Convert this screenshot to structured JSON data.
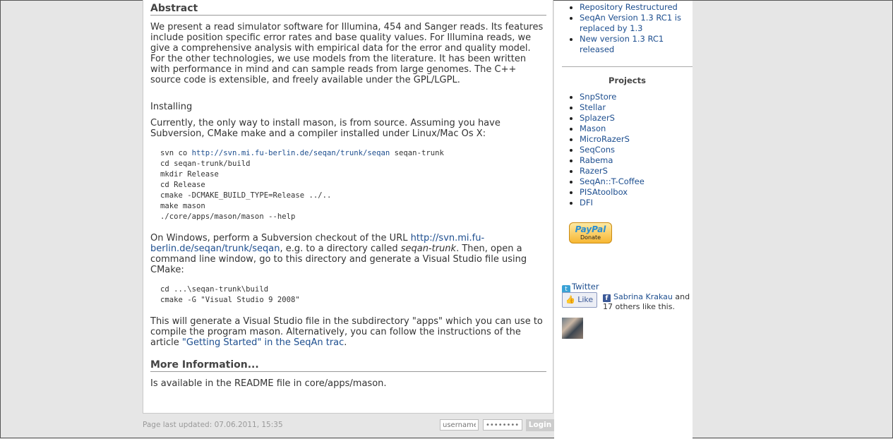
{
  "main": {
    "abstract_heading": "Abstract",
    "abstract_text": "We present a read simulator software for Illumina, 454 and Sanger reads. Its features include position specific error rates and base quality values. For Illumina reads, we give a comprehensive analysis with empirical data for the error and quality model. For the other technologies, we use models from the literature. It has been written with performance in mind and can sample reads from large genomes. The C++ source code is extensible, and freely available under the GPL/LGPL.",
    "installing_label": "Installing",
    "install_intro": "Currently, the only way to install mason, is from source. Assuming you have Subversion, CMake make and a compiler installed under Linux/Mac Os X:",
    "code1": {
      "line1_prefix": "svn co ",
      "line1_link": "http://svn.mi.fu-berlin.de/seqan/trunk/seqan",
      "line1_suffix": " seqan-trunk",
      "line2": "cd seqan-trunk/build",
      "line3": "mkdir Release",
      "line4": "cd Release",
      "line5": "cmake -DCMAKE_BUILD_TYPE=Release ../..",
      "line6": "make mason",
      "line7": "./core/apps/mason/mason --help"
    },
    "windows_text_1": "On Windows, perform a Subversion checkout of the URL ",
    "windows_link": "http://svn.mi.fu-berlin.de/seqan/trunk/seqan",
    "windows_text_2": ", e.g. to a directory called ",
    "windows_em": "seqan-trunk",
    "windows_text_3": ". Then, open a command line window, go to this directory and generate a Visual Studio file using CMake:",
    "code2": {
      "line1": "cd ...\\seqan-trunk\\build",
      "line2": "cmake -G \"Visual Studio 9 2008\""
    },
    "generate_text": "This will generate a Visual Studio file in the subdirectory \"apps\" which you can use to compile the program mason. Alternatively, you can follow the instructions of the article ",
    "getting_started_link": "\"Getting Started\" in the SeqAn trac",
    "generate_text_end": ".",
    "more_info_heading": "More Information...",
    "more_info_text": "Is available in the README file in core/apps/mason."
  },
  "sidebar": {
    "news": [
      "Repository Restructured",
      "SeqAn Version 1.3 RC1 is replaced by 1.3",
      "New version 1.3 RC1 released"
    ],
    "projects_title": "Projects",
    "projects": [
      "SnpStore",
      "Stellar",
      "SplazerS",
      "Mason",
      "MicroRazerS",
      "SeqCons",
      "Rabema",
      "RazerS",
      "SeqAn::T-Coffee",
      "PISAtoolbox",
      "DFI"
    ],
    "paypal_label": "PayPal",
    "paypal_donate": "Donate",
    "twitter_label": "Twitter",
    "like_button": "Like",
    "like_name": "Sabrina Krakau",
    "like_rest": " and 17 others like this."
  },
  "footer": {
    "last_updated": "Page last updated: 07.06.2011, 15:35",
    "username_placeholder": "username",
    "password_placeholder": "••••••••",
    "login_label": "Login"
  }
}
